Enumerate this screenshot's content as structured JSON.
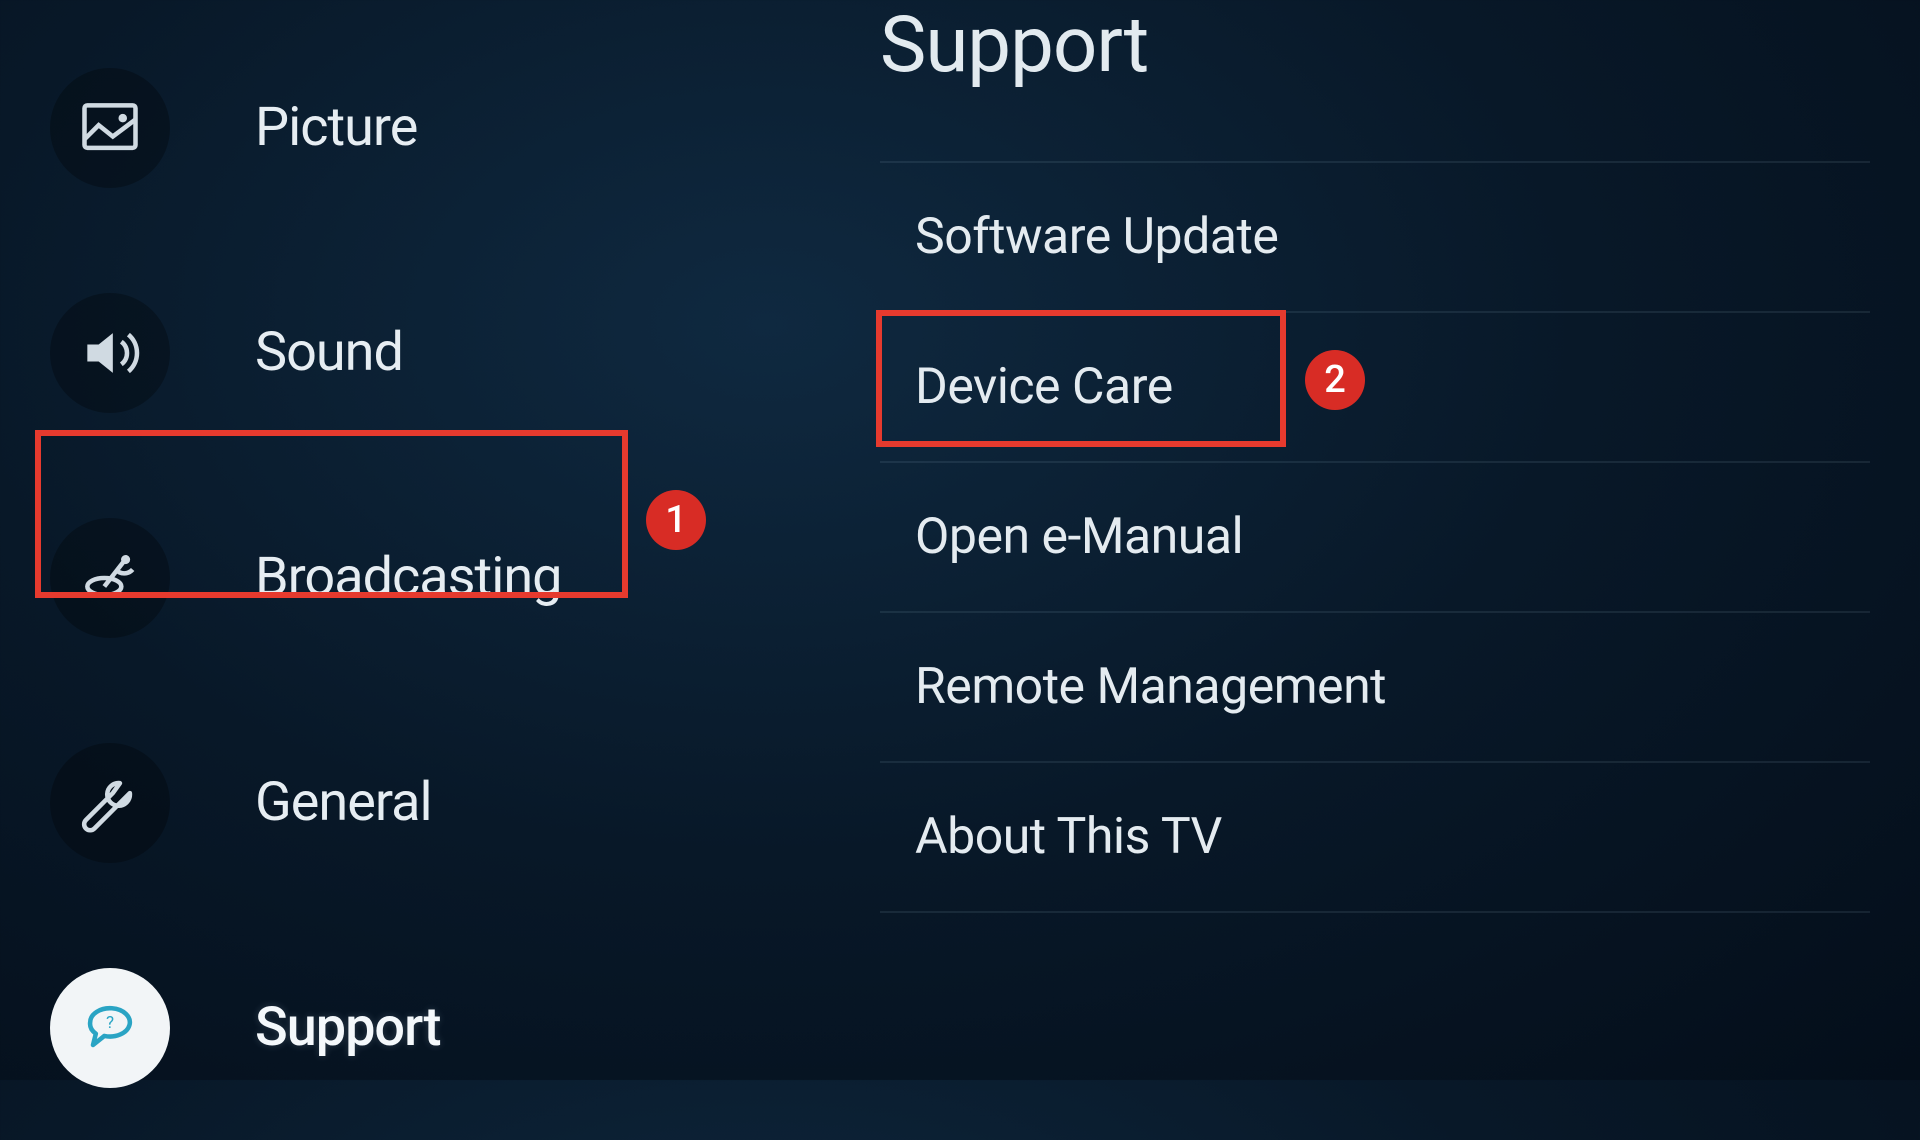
{
  "sidebar": {
    "items": [
      {
        "label": "Picture",
        "icon": "picture"
      },
      {
        "label": "Sound",
        "icon": "sound"
      },
      {
        "label": "Broadcasting",
        "icon": "broadcast"
      },
      {
        "label": "General",
        "icon": "wrench"
      },
      {
        "label": "Support",
        "icon": "support",
        "active": true
      }
    ]
  },
  "content": {
    "title": "Support",
    "items": [
      {
        "label": "Software Update"
      },
      {
        "label": "Device Care"
      },
      {
        "label": "Open e-Manual"
      },
      {
        "label": "Remote Management"
      },
      {
        "label": "About This TV"
      }
    ]
  },
  "annotations": [
    {
      "number": "1"
    },
    {
      "number": "2"
    }
  ]
}
